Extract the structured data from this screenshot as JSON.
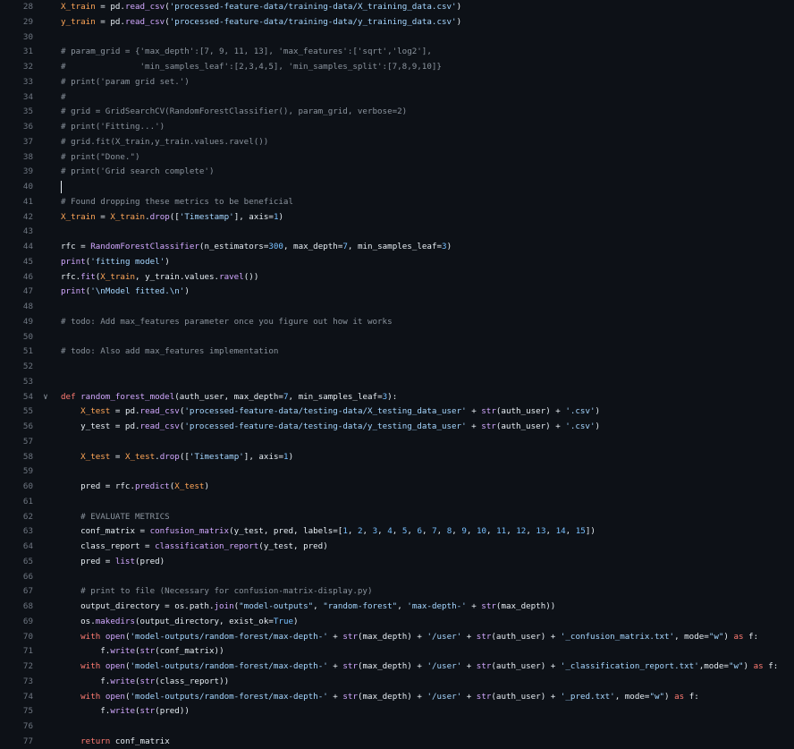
{
  "colors": {
    "background": "#0d1117",
    "line_number": "#6e7681",
    "variable": "#ffa657",
    "text": "#e6edf3",
    "string": "#a5d6ff",
    "comment": "#8b949e",
    "function": "#d2a8ff",
    "keyword": "#ff7b72",
    "number": "#79c0ff"
  },
  "editor": {
    "lines": [
      {
        "num": "28",
        "tokens": [
          [
            "v",
            "X_train"
          ],
          [
            "o",
            " = pd."
          ],
          [
            "f",
            "read_csv"
          ],
          [
            "o",
            "("
          ],
          [
            "s",
            "'processed-feature-data/training-data/X_training_data.csv'"
          ],
          [
            "o",
            ")"
          ]
        ]
      },
      {
        "num": "29",
        "tokens": [
          [
            "v",
            "y_train"
          ],
          [
            "o",
            " = pd."
          ],
          [
            "f",
            "read_csv"
          ],
          [
            "o",
            "("
          ],
          [
            "s",
            "'processed-feature-data/training-data/y_training_data.csv'"
          ],
          [
            "o",
            ")"
          ]
        ]
      },
      {
        "num": "30",
        "tokens": []
      },
      {
        "num": "31",
        "tokens": [
          [
            "c",
            "# param_grid = {'max_depth':[7, 9, 11, 13], 'max_features':['sqrt','log2'],"
          ]
        ]
      },
      {
        "num": "32",
        "tokens": [
          [
            "c",
            "#               'min_samples_leaf':[2,3,4,5], 'min_samples_split':[7,8,9,10]}"
          ]
        ]
      },
      {
        "num": "33",
        "tokens": [
          [
            "c",
            "# print('param grid set.')"
          ]
        ]
      },
      {
        "num": "34",
        "tokens": [
          [
            "c",
            "#"
          ]
        ]
      },
      {
        "num": "35",
        "tokens": [
          [
            "c",
            "# grid = GridSearchCV(RandomForestClassifier(), param_grid, verbose=2)"
          ]
        ]
      },
      {
        "num": "36",
        "tokens": [
          [
            "c",
            "# print('Fitting...')"
          ]
        ]
      },
      {
        "num": "37",
        "tokens": [
          [
            "c",
            "# grid.fit(X_train,y_train.values.ravel())"
          ]
        ]
      },
      {
        "num": "38",
        "tokens": [
          [
            "c",
            "# print(\"Done.\")"
          ]
        ]
      },
      {
        "num": "39",
        "tokens": [
          [
            "c",
            "# print('Grid search complete')"
          ]
        ]
      },
      {
        "num": "40",
        "tokens": [],
        "cursor": true
      },
      {
        "num": "41",
        "tokens": [
          [
            "c",
            "# Found dropping these metrics to be beneficial"
          ]
        ]
      },
      {
        "num": "42",
        "tokens": [
          [
            "v",
            "X_train"
          ],
          [
            "o",
            " = "
          ],
          [
            "v",
            "X_train"
          ],
          [
            "o",
            "."
          ],
          [
            "f",
            "drop"
          ],
          [
            "o",
            "(["
          ],
          [
            "s",
            "'Timestamp'"
          ],
          [
            "o",
            "], axis="
          ],
          [
            "n",
            "1"
          ],
          [
            "o",
            ")"
          ]
        ]
      },
      {
        "num": "43",
        "tokens": []
      },
      {
        "num": "44",
        "tokens": [
          [
            "o",
            "rfc = "
          ],
          [
            "f",
            "RandomForestClassifier"
          ],
          [
            "o",
            "(n_estimators="
          ],
          [
            "n",
            "300"
          ],
          [
            "o",
            ", max_depth="
          ],
          [
            "n",
            "7"
          ],
          [
            "o",
            ", min_samples_leaf="
          ],
          [
            "n",
            "3"
          ],
          [
            "o",
            ")"
          ]
        ]
      },
      {
        "num": "45",
        "tokens": [
          [
            "f",
            "print"
          ],
          [
            "o",
            "("
          ],
          [
            "s",
            "'fitting model'"
          ],
          [
            "o",
            ")"
          ]
        ]
      },
      {
        "num": "46",
        "tokens": [
          [
            "o",
            "rfc."
          ],
          [
            "f",
            "fit"
          ],
          [
            "o",
            "("
          ],
          [
            "v",
            "X_train"
          ],
          [
            "o",
            ", y_train.values."
          ],
          [
            "f",
            "ravel"
          ],
          [
            "o",
            "())"
          ]
        ]
      },
      {
        "num": "47",
        "tokens": [
          [
            "f",
            "print"
          ],
          [
            "o",
            "("
          ],
          [
            "s",
            "'\\nModel fitted.\\n'"
          ],
          [
            "o",
            ")"
          ]
        ]
      },
      {
        "num": "48",
        "tokens": []
      },
      {
        "num": "49",
        "tokens": [
          [
            "c",
            "# todo: Add max_features parameter once you figure out how it works"
          ]
        ]
      },
      {
        "num": "50",
        "tokens": []
      },
      {
        "num": "51",
        "tokens": [
          [
            "c",
            "# todo: Also add max_features implementation"
          ]
        ]
      },
      {
        "num": "52",
        "tokens": []
      },
      {
        "num": "53",
        "tokens": []
      },
      {
        "num": "54",
        "fold": "∨",
        "tokens": [
          [
            "k",
            "def "
          ],
          [
            "f",
            "random_forest_model"
          ],
          [
            "o",
            "(auth_user, max_depth="
          ],
          [
            "n",
            "7"
          ],
          [
            "o",
            ", min_samples_leaf="
          ],
          [
            "n",
            "3"
          ],
          [
            "o",
            "):"
          ]
        ]
      },
      {
        "num": "55",
        "tokens": [
          [
            "o",
            "    "
          ],
          [
            "v",
            "X_test"
          ],
          [
            "o",
            " = pd."
          ],
          [
            "f",
            "read_csv"
          ],
          [
            "o",
            "("
          ],
          [
            "s",
            "'processed-feature-data/testing-data/X_testing_data_user'"
          ],
          [
            "o",
            " + "
          ],
          [
            "f",
            "str"
          ],
          [
            "o",
            "(auth_user) + "
          ],
          [
            "s",
            "'.csv'"
          ],
          [
            "o",
            ")"
          ]
        ]
      },
      {
        "num": "56",
        "tokens": [
          [
            "o",
            "    y_test = pd."
          ],
          [
            "f",
            "read_csv"
          ],
          [
            "o",
            "("
          ],
          [
            "s",
            "'processed-feature-data/testing-data/y_testing_data_user'"
          ],
          [
            "o",
            " + "
          ],
          [
            "f",
            "str"
          ],
          [
            "o",
            "(auth_user) + "
          ],
          [
            "s",
            "'.csv'"
          ],
          [
            "o",
            ")"
          ]
        ]
      },
      {
        "num": "57",
        "tokens": []
      },
      {
        "num": "58",
        "tokens": [
          [
            "o",
            "    "
          ],
          [
            "v",
            "X_test"
          ],
          [
            "o",
            " = "
          ],
          [
            "v",
            "X_test"
          ],
          [
            "o",
            "."
          ],
          [
            "f",
            "drop"
          ],
          [
            "o",
            "(["
          ],
          [
            "s",
            "'Timestamp'"
          ],
          [
            "o",
            "], axis="
          ],
          [
            "n",
            "1"
          ],
          [
            "o",
            ")"
          ]
        ]
      },
      {
        "num": "59",
        "tokens": []
      },
      {
        "num": "60",
        "tokens": [
          [
            "o",
            "    pred = rfc."
          ],
          [
            "f",
            "predict"
          ],
          [
            "o",
            "("
          ],
          [
            "v",
            "X_test"
          ],
          [
            "o",
            ")"
          ]
        ]
      },
      {
        "num": "61",
        "tokens": []
      },
      {
        "num": "62",
        "tokens": [
          [
            "o",
            "    "
          ],
          [
            "c",
            "# EVALUATE METRICS"
          ]
        ]
      },
      {
        "num": "63",
        "tokens": [
          [
            "o",
            "    conf_matrix = "
          ],
          [
            "f",
            "confusion_matrix"
          ],
          [
            "o",
            "(y_test, pred, labels=["
          ],
          [
            "n",
            "1"
          ],
          [
            "o",
            ", "
          ],
          [
            "n",
            "2"
          ],
          [
            "o",
            ", "
          ],
          [
            "n",
            "3"
          ],
          [
            "o",
            ", "
          ],
          [
            "n",
            "4"
          ],
          [
            "o",
            ", "
          ],
          [
            "n",
            "5"
          ],
          [
            "o",
            ", "
          ],
          [
            "n",
            "6"
          ],
          [
            "o",
            ", "
          ],
          [
            "n",
            "7"
          ],
          [
            "o",
            ", "
          ],
          [
            "n",
            "8"
          ],
          [
            "o",
            ", "
          ],
          [
            "n",
            "9"
          ],
          [
            "o",
            ", "
          ],
          [
            "n",
            "10"
          ],
          [
            "o",
            ", "
          ],
          [
            "n",
            "11"
          ],
          [
            "o",
            ", "
          ],
          [
            "n",
            "12"
          ],
          [
            "o",
            ", "
          ],
          [
            "n",
            "13"
          ],
          [
            "o",
            ", "
          ],
          [
            "n",
            "14"
          ],
          [
            "o",
            ", "
          ],
          [
            "n",
            "15"
          ],
          [
            "o",
            "])"
          ]
        ]
      },
      {
        "num": "64",
        "tokens": [
          [
            "o",
            "    class_report = "
          ],
          [
            "f",
            "classification_report"
          ],
          [
            "o",
            "(y_test, pred)"
          ]
        ]
      },
      {
        "num": "65",
        "tokens": [
          [
            "o",
            "    pred = "
          ],
          [
            "f",
            "list"
          ],
          [
            "o",
            "(pred)"
          ]
        ]
      },
      {
        "num": "66",
        "tokens": []
      },
      {
        "num": "67",
        "tokens": [
          [
            "o",
            "    "
          ],
          [
            "c",
            "# print to file (Necessary for confusion-matrix-display.py)"
          ]
        ]
      },
      {
        "num": "68",
        "tokens": [
          [
            "o",
            "    output_directory = os.path."
          ],
          [
            "f",
            "join"
          ],
          [
            "o",
            "("
          ],
          [
            "s",
            "\"model-outputs\""
          ],
          [
            "o",
            ", "
          ],
          [
            "s",
            "\"random-forest\""
          ],
          [
            "o",
            ", "
          ],
          [
            "s",
            "'max-depth-'"
          ],
          [
            "o",
            " + "
          ],
          [
            "f",
            "str"
          ],
          [
            "o",
            "(max_depth))"
          ]
        ]
      },
      {
        "num": "69",
        "tokens": [
          [
            "o",
            "    os."
          ],
          [
            "f",
            "makedirs"
          ],
          [
            "o",
            "(output_directory, exist_ok="
          ],
          [
            "n",
            "True"
          ],
          [
            "o",
            ")"
          ]
        ]
      },
      {
        "num": "70",
        "tokens": [
          [
            "o",
            "    "
          ],
          [
            "k",
            "with "
          ],
          [
            "f",
            "open"
          ],
          [
            "o",
            "("
          ],
          [
            "s",
            "'model-outputs/random-forest/max-depth-'"
          ],
          [
            "o",
            " + "
          ],
          [
            "f",
            "str"
          ],
          [
            "o",
            "(max_depth) + "
          ],
          [
            "s",
            "'/user'"
          ],
          [
            "o",
            " + "
          ],
          [
            "f",
            "str"
          ],
          [
            "o",
            "(auth_user) + "
          ],
          [
            "s",
            "'_confusion_matrix.txt'"
          ],
          [
            "o",
            ", mode="
          ],
          [
            "s",
            "\"w\""
          ],
          [
            "o",
            ") "
          ],
          [
            "k",
            "as"
          ],
          [
            "o",
            " f:"
          ]
        ]
      },
      {
        "num": "71",
        "tokens": [
          [
            "o",
            "        f."
          ],
          [
            "f",
            "write"
          ],
          [
            "o",
            "("
          ],
          [
            "f",
            "str"
          ],
          [
            "o",
            "(conf_matrix))"
          ]
        ]
      },
      {
        "num": "72",
        "tokens": [
          [
            "o",
            "    "
          ],
          [
            "k",
            "with "
          ],
          [
            "f",
            "open"
          ],
          [
            "o",
            "("
          ],
          [
            "s",
            "'model-outputs/random-forest/max-depth-'"
          ],
          [
            "o",
            " + "
          ],
          [
            "f",
            "str"
          ],
          [
            "o",
            "(max_depth) + "
          ],
          [
            "s",
            "'/user'"
          ],
          [
            "o",
            " + "
          ],
          [
            "f",
            "str"
          ],
          [
            "o",
            "(auth_user) + "
          ],
          [
            "s",
            "'_classification_report.txt'"
          ],
          [
            "o",
            ",mode="
          ],
          [
            "s",
            "\"w\""
          ],
          [
            "o",
            ") "
          ],
          [
            "k",
            "as"
          ],
          [
            "o",
            " f:"
          ]
        ]
      },
      {
        "num": "73",
        "tokens": [
          [
            "o",
            "        f."
          ],
          [
            "f",
            "write"
          ],
          [
            "o",
            "("
          ],
          [
            "f",
            "str"
          ],
          [
            "o",
            "(class_report))"
          ]
        ]
      },
      {
        "num": "74",
        "tokens": [
          [
            "o",
            "    "
          ],
          [
            "k",
            "with "
          ],
          [
            "f",
            "open"
          ],
          [
            "o",
            "("
          ],
          [
            "s",
            "'model-outputs/random-forest/max-depth-'"
          ],
          [
            "o",
            " + "
          ],
          [
            "f",
            "str"
          ],
          [
            "o",
            "(max_depth) + "
          ],
          [
            "s",
            "'/user'"
          ],
          [
            "o",
            " + "
          ],
          [
            "f",
            "str"
          ],
          [
            "o",
            "(auth_user) + "
          ],
          [
            "s",
            "'_pred.txt'"
          ],
          [
            "o",
            ", mode="
          ],
          [
            "s",
            "\"w\""
          ],
          [
            "o",
            ") "
          ],
          [
            "k",
            "as"
          ],
          [
            "o",
            " f:"
          ]
        ]
      },
      {
        "num": "75",
        "tokens": [
          [
            "o",
            "        f."
          ],
          [
            "f",
            "write"
          ],
          [
            "o",
            "("
          ],
          [
            "f",
            "str"
          ],
          [
            "o",
            "(pred))"
          ]
        ]
      },
      {
        "num": "76",
        "tokens": []
      },
      {
        "num": "77",
        "tokens": [
          [
            "o",
            "    "
          ],
          [
            "k",
            "return"
          ],
          [
            "o",
            " conf_matrix"
          ]
        ]
      }
    ]
  }
}
